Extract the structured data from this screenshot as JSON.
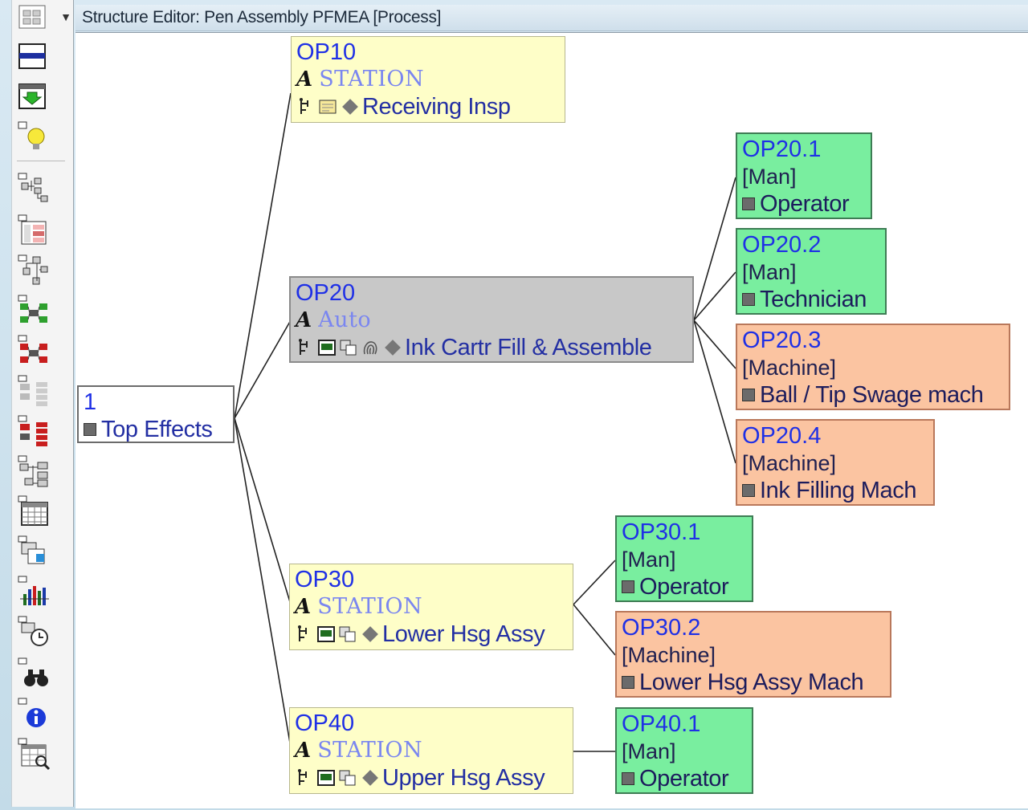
{
  "window": {
    "title": "Structure Editor: Pen Assembly PFMEA [Process]"
  },
  "toolbar": {
    "icons": [
      "window-layout-icon",
      "horizontal-split-icon",
      "import-arrow-icon",
      "lightbulb-icon",
      "structure-tree-icon",
      "structure-table-icon",
      "tree-branch-icon",
      "function-net-green-icon",
      "function-net-red-icon",
      "failure-tree-icon",
      "failure-net-red-icon",
      "tree-grid-icon",
      "spreadsheet-icon",
      "form-sheet-icon",
      "bar-chart-icon",
      "clock-icon",
      "binoculars-icon",
      "info-icon",
      "table-search-icon"
    ]
  },
  "root": {
    "id": "1",
    "label": "Top Effects"
  },
  "operations": [
    {
      "id": "OP10",
      "category": "STATION",
      "label": "Receiving Insp",
      "selected": false
    },
    {
      "id": "OP20",
      "category": "Auto",
      "label": "Ink Cartr Fill & Assemble",
      "selected": true
    },
    {
      "id": "OP30",
      "category": "STATION",
      "label": "Lower Hsg Assy",
      "selected": false
    },
    {
      "id": "OP40",
      "category": "STATION",
      "label": "Upper Hsg Assy",
      "selected": false
    }
  ],
  "elements": [
    {
      "id": "OP20.1",
      "type": "[Man]",
      "label": "Operator",
      "kind": "man"
    },
    {
      "id": "OP20.2",
      "type": "[Man]",
      "label": "Technician",
      "kind": "man"
    },
    {
      "id": "OP20.3",
      "type": "[Machine]",
      "label": "Ball / Tip Swage mach",
      "kind": "machine"
    },
    {
      "id": "OP20.4",
      "type": "[Machine]",
      "label": "Ink Filling Mach",
      "kind": "machine"
    },
    {
      "id": "OP30.1",
      "type": "[Man]",
      "label": "Operator",
      "kind": "man"
    },
    {
      "id": "OP30.2",
      "type": "[Machine]",
      "label": "Lower Hsg Assy Mach",
      "kind": "machine"
    },
    {
      "id": "OP40.1",
      "type": "[Man]",
      "label": "Operator",
      "kind": "man"
    }
  ],
  "colors": {
    "station": "#fefec8",
    "selected": "#c8c8c8",
    "man": "#79ee9f",
    "machine": "#fbc4a1",
    "id_text": "#1f30e6",
    "connector": "#222222"
  }
}
